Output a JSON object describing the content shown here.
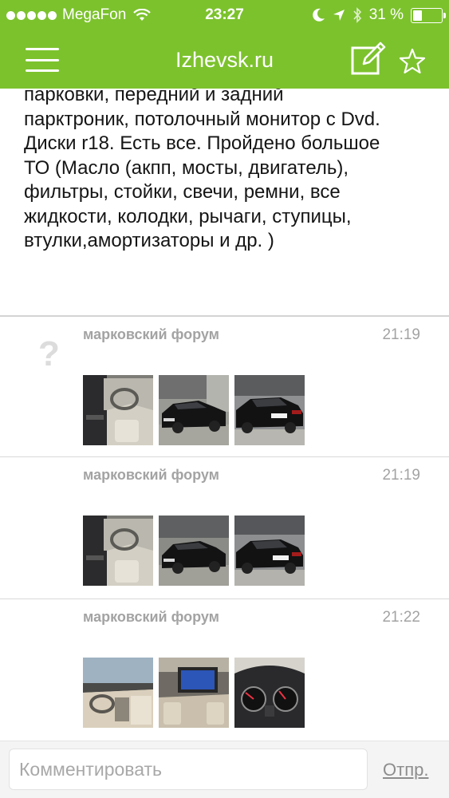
{
  "status_bar": {
    "carrier": "MegaFon",
    "time": "23:27",
    "battery": "31 %",
    "battery_level": 0.31
  },
  "nav": {
    "title": "Izhevsk.ru",
    "menu_icon": "hamburger-menu-icon",
    "compose_icon": "compose-icon",
    "favorite_icon": "star-icon"
  },
  "post": {
    "lines": [
      "парковки, передний и задний",
      "парктроник, потолочный монитор с Dvd.",
      "Диски r18. Есть все. Пройдено большое",
      "ТО (Масло (акпп, мосты, двигатель),",
      "фильтры, стойки, свечи, ремни, все",
      "жидкости, колодки, рычаги, ступицы,",
      "втулки,амортизаторы и др. )"
    ]
  },
  "comments": [
    {
      "author": "марковский форум",
      "time": "21:19",
      "avatar": "?",
      "photos": [
        "car-interior-photo",
        "black-sedan-front-photo",
        "black-sedan-rear-photo"
      ]
    },
    {
      "author": "марковский форум",
      "time": "21:19",
      "photos": [
        "car-interior-photo",
        "black-sedan-front-photo",
        "black-sedan-rear-photo"
      ]
    },
    {
      "author": "марковский форум",
      "time": "21:22",
      "photos": [
        "car-dashboard-photo",
        "ceiling-monitor-photo",
        "instrument-cluster-photo"
      ]
    }
  ],
  "comment_bar": {
    "placeholder": "Комментировать",
    "send_label": "Отпр."
  },
  "colors": {
    "accent": "#7cc22d",
    "meta_text": "#a3a3a3"
  }
}
